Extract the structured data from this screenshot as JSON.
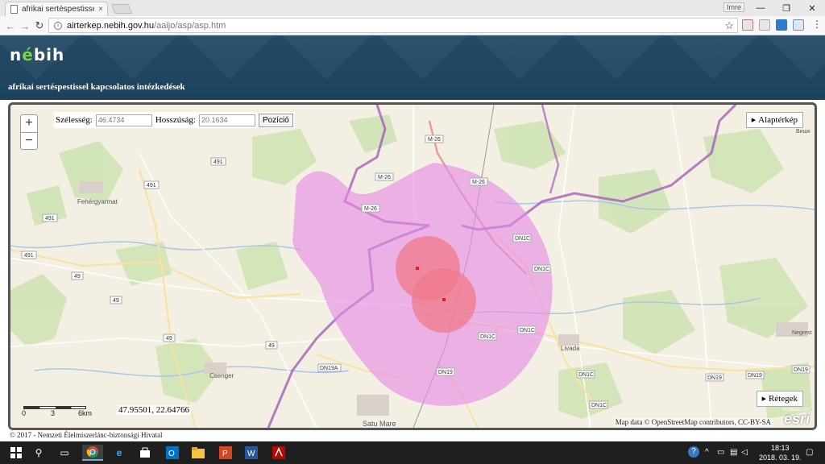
{
  "browser": {
    "tab_title": "afrikai sertéspestissel kap",
    "url_host": "airterkep.nebih.gov.hu",
    "url_path": "/aaijo/asp/asp.htm",
    "user_badge": "Imre",
    "btn_min": "—",
    "btn_max": "❐",
    "btn_close": "✕",
    "tab_close": "×"
  },
  "header": {
    "logo_pre": "n",
    "logo_mid": "é",
    "logo_post": "b",
    "logo_i": "i",
    "logo_h": "h",
    "title": "afrikai sertéspestissel kapcsolatos intézkedések"
  },
  "map": {
    "zoom_in": "+",
    "zoom_out": "−",
    "lat_label": "Szélesség:",
    "lat_value": "46.4734",
    "lon_label": "Hosszúság:",
    "lon_value": "20.1634",
    "position_button": "Pozíció",
    "basemap_button": "Alaptérkép",
    "layers_button": "Rétegek",
    "scale_labels": [
      "0",
      "3",
      "6km"
    ],
    "mouse_coords": "47.95501, 22.64766",
    "attribution": "Map data © OpenStreetMap contributors, CC-BY-SA",
    "esri_powered": "POWERED BY",
    "esri_name": "esri",
    "place_labels": [
      "Fehérgyarmat",
      "Csenger",
      "Livada",
      "Satu Mare",
      "Negrest",
      "Вишк"
    ],
    "road_labels": [
      "M-26",
      "M-26",
      "M-26",
      "M-26",
      "491",
      "491",
      "491",
      "491",
      "49",
      "49",
      "49",
      "49",
      "DN1C",
      "DN1C",
      "DN1C",
      "DN1C",
      "DN1C",
      "DN1C",
      "DN19",
      "DN19",
      "DN19",
      "DN19",
      "DN19A"
    ],
    "colors": {
      "zone_outer": "#e58be6",
      "zone_inner": "#f07a8a",
      "border": "#a45fb8"
    }
  },
  "footer": {
    "copyright": "© 2017 - Nemzeti Élelmiszerlánc-biztonsági Hivatal"
  },
  "taskbar": {
    "time": "18:13",
    "date": "2018. 03. 19."
  }
}
